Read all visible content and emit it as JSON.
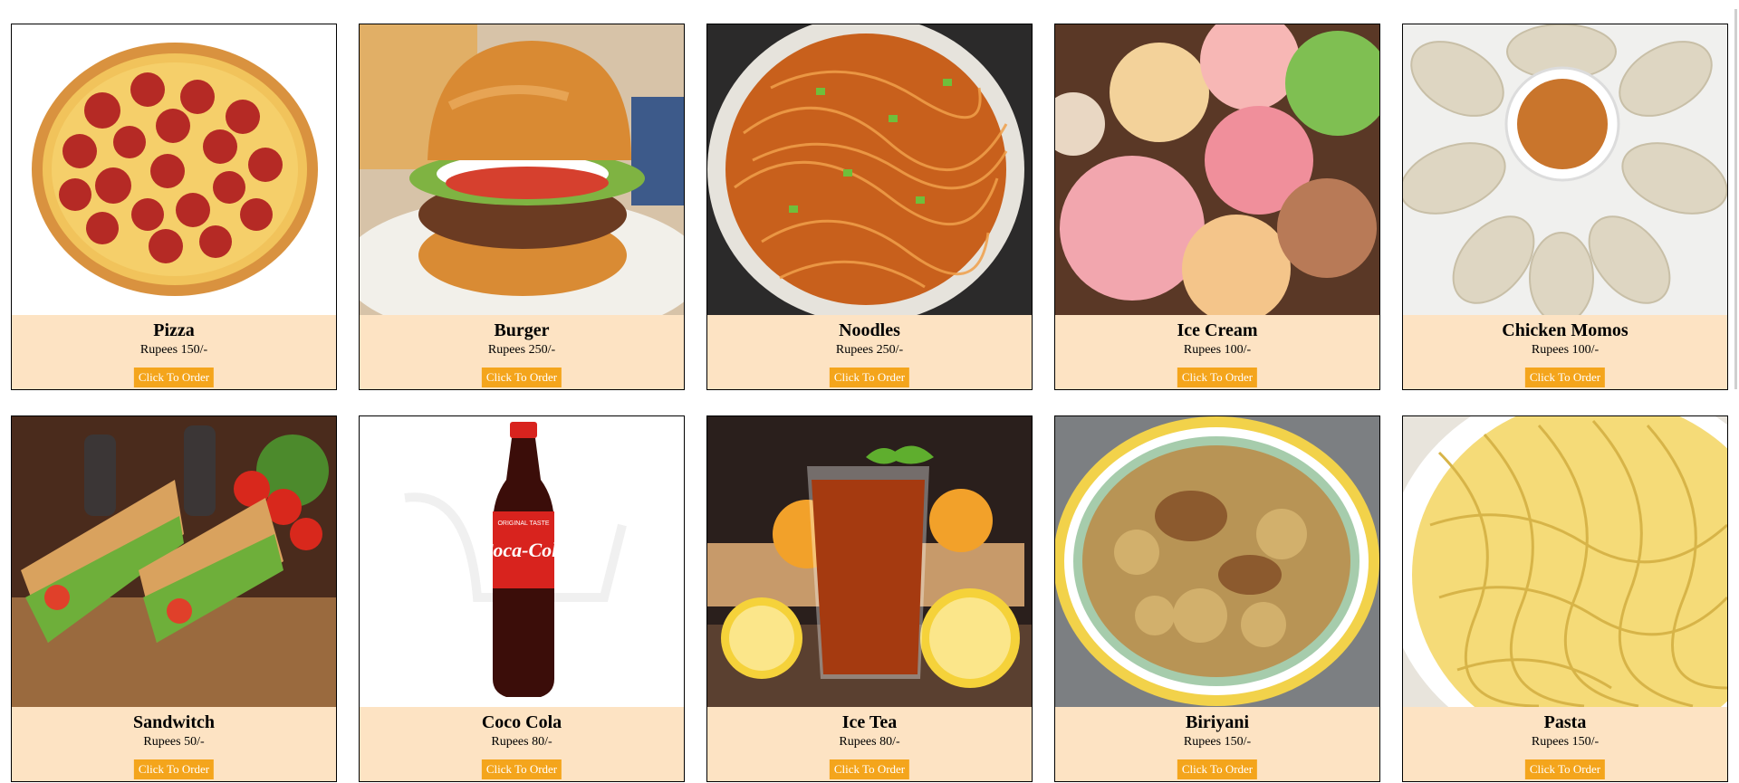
{
  "menu": {
    "order_label": "Click To Order",
    "items": [
      {
        "name": "Pizza",
        "price": "Rupees 150/-",
        "icon": "pizza-image"
      },
      {
        "name": "Burger",
        "price": "Rupees 250/-",
        "icon": "burger-image"
      },
      {
        "name": "Noodles",
        "price": "Rupees 250/-",
        "icon": "noodles-image"
      },
      {
        "name": "Ice Cream",
        "price": "Rupees 100/-",
        "icon": "ice-cream-image"
      },
      {
        "name": "Chicken Momos",
        "price": "Rupees 100/-",
        "icon": "momos-image"
      },
      {
        "name": "Sandwitch",
        "price": "Rupees 50/-",
        "icon": "sandwich-image"
      },
      {
        "name": "Coco Cola",
        "price": "Rupees 80/-",
        "icon": "cola-bottle-image"
      },
      {
        "name": "Ice Tea",
        "price": "Rupees 80/-",
        "icon": "ice-tea-image"
      },
      {
        "name": "Biriyani",
        "price": "Rupees 150/-",
        "icon": "biriyani-image"
      },
      {
        "name": "Pasta",
        "price": "Rupees 150/-",
        "icon": "pasta-image"
      }
    ]
  },
  "colors": {
    "card_bg": "#fde3c3",
    "button": "#f4a51c",
    "button_text": "#ffffff",
    "border": "#000000"
  },
  "logos": {
    "cola_label": "Coca-Cola",
    "cola_tag": "ORIGINAL TASTE"
  }
}
